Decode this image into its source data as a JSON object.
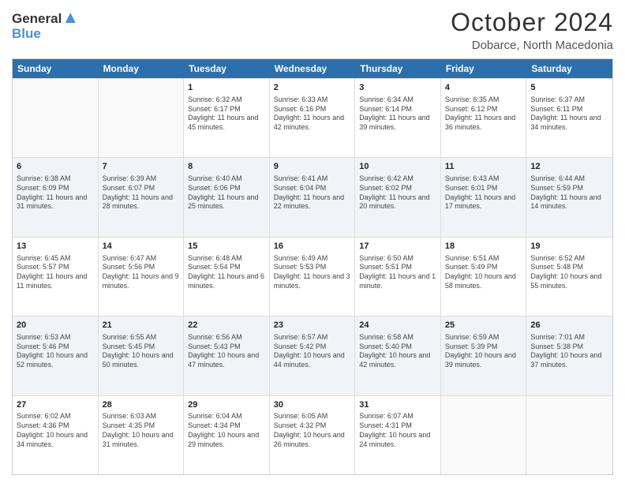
{
  "header": {
    "logo_line1": "General",
    "logo_line2": "Blue",
    "month": "October 2024",
    "location": "Dobarce, North Macedonia"
  },
  "days_of_week": [
    "Sunday",
    "Monday",
    "Tuesday",
    "Wednesday",
    "Thursday",
    "Friday",
    "Saturday"
  ],
  "weeks": [
    {
      "shaded": false,
      "days": [
        {
          "num": "",
          "info": ""
        },
        {
          "num": "",
          "info": ""
        },
        {
          "num": "1",
          "info": "Sunrise: 6:32 AM\nSunset: 6:17 PM\nDaylight: 11 hours and 45 minutes."
        },
        {
          "num": "2",
          "info": "Sunrise: 6:33 AM\nSunset: 6:16 PM\nDaylight: 11 hours and 42 minutes."
        },
        {
          "num": "3",
          "info": "Sunrise: 6:34 AM\nSunset: 6:14 PM\nDaylight: 11 hours and 39 minutes."
        },
        {
          "num": "4",
          "info": "Sunrise: 6:35 AM\nSunset: 6:12 PM\nDaylight: 11 hours and 36 minutes."
        },
        {
          "num": "5",
          "info": "Sunrise: 6:37 AM\nSunset: 6:11 PM\nDaylight: 11 hours and 34 minutes."
        }
      ]
    },
    {
      "shaded": true,
      "days": [
        {
          "num": "6",
          "info": "Sunrise: 6:38 AM\nSunset: 6:09 PM\nDaylight: 11 hours and 31 minutes."
        },
        {
          "num": "7",
          "info": "Sunrise: 6:39 AM\nSunset: 6:07 PM\nDaylight: 11 hours and 28 minutes."
        },
        {
          "num": "8",
          "info": "Sunrise: 6:40 AM\nSunset: 6:06 PM\nDaylight: 11 hours and 25 minutes."
        },
        {
          "num": "9",
          "info": "Sunrise: 6:41 AM\nSunset: 6:04 PM\nDaylight: 11 hours and 22 minutes."
        },
        {
          "num": "10",
          "info": "Sunrise: 6:42 AM\nSunset: 6:02 PM\nDaylight: 11 hours and 20 minutes."
        },
        {
          "num": "11",
          "info": "Sunrise: 6:43 AM\nSunset: 6:01 PM\nDaylight: 11 hours and 17 minutes."
        },
        {
          "num": "12",
          "info": "Sunrise: 6:44 AM\nSunset: 5:59 PM\nDaylight: 11 hours and 14 minutes."
        }
      ]
    },
    {
      "shaded": false,
      "days": [
        {
          "num": "13",
          "info": "Sunrise: 6:45 AM\nSunset: 5:57 PM\nDaylight: 11 hours and 11 minutes."
        },
        {
          "num": "14",
          "info": "Sunrise: 6:47 AM\nSunset: 5:56 PM\nDaylight: 11 hours and 9 minutes."
        },
        {
          "num": "15",
          "info": "Sunrise: 6:48 AM\nSunset: 5:54 PM\nDaylight: 11 hours and 6 minutes."
        },
        {
          "num": "16",
          "info": "Sunrise: 6:49 AM\nSunset: 5:53 PM\nDaylight: 11 hours and 3 minutes."
        },
        {
          "num": "17",
          "info": "Sunrise: 6:50 AM\nSunset: 5:51 PM\nDaylight: 11 hours and 1 minute."
        },
        {
          "num": "18",
          "info": "Sunrise: 6:51 AM\nSunset: 5:49 PM\nDaylight: 10 hours and 58 minutes."
        },
        {
          "num": "19",
          "info": "Sunrise: 6:52 AM\nSunset: 5:48 PM\nDaylight: 10 hours and 55 minutes."
        }
      ]
    },
    {
      "shaded": true,
      "days": [
        {
          "num": "20",
          "info": "Sunrise: 6:53 AM\nSunset: 5:46 PM\nDaylight: 10 hours and 52 minutes."
        },
        {
          "num": "21",
          "info": "Sunrise: 6:55 AM\nSunset: 5:45 PM\nDaylight: 10 hours and 50 minutes."
        },
        {
          "num": "22",
          "info": "Sunrise: 6:56 AM\nSunset: 5:43 PM\nDaylight: 10 hours and 47 minutes."
        },
        {
          "num": "23",
          "info": "Sunrise: 6:57 AM\nSunset: 5:42 PM\nDaylight: 10 hours and 44 minutes."
        },
        {
          "num": "24",
          "info": "Sunrise: 6:58 AM\nSunset: 5:40 PM\nDaylight: 10 hours and 42 minutes."
        },
        {
          "num": "25",
          "info": "Sunrise: 6:59 AM\nSunset: 5:39 PM\nDaylight: 10 hours and 39 minutes."
        },
        {
          "num": "26",
          "info": "Sunrise: 7:01 AM\nSunset: 5:38 PM\nDaylight: 10 hours and 37 minutes."
        }
      ]
    },
    {
      "shaded": false,
      "days": [
        {
          "num": "27",
          "info": "Sunrise: 6:02 AM\nSunset: 4:36 PM\nDaylight: 10 hours and 34 minutes."
        },
        {
          "num": "28",
          "info": "Sunrise: 6:03 AM\nSunset: 4:35 PM\nDaylight: 10 hours and 31 minutes."
        },
        {
          "num": "29",
          "info": "Sunrise: 6:04 AM\nSunset: 4:34 PM\nDaylight: 10 hours and 29 minutes."
        },
        {
          "num": "30",
          "info": "Sunrise: 6:05 AM\nSunset: 4:32 PM\nDaylight: 10 hours and 26 minutes."
        },
        {
          "num": "31",
          "info": "Sunrise: 6:07 AM\nSunset: 4:31 PM\nDaylight: 10 hours and 24 minutes."
        },
        {
          "num": "",
          "info": ""
        },
        {
          "num": "",
          "info": ""
        }
      ]
    }
  ]
}
